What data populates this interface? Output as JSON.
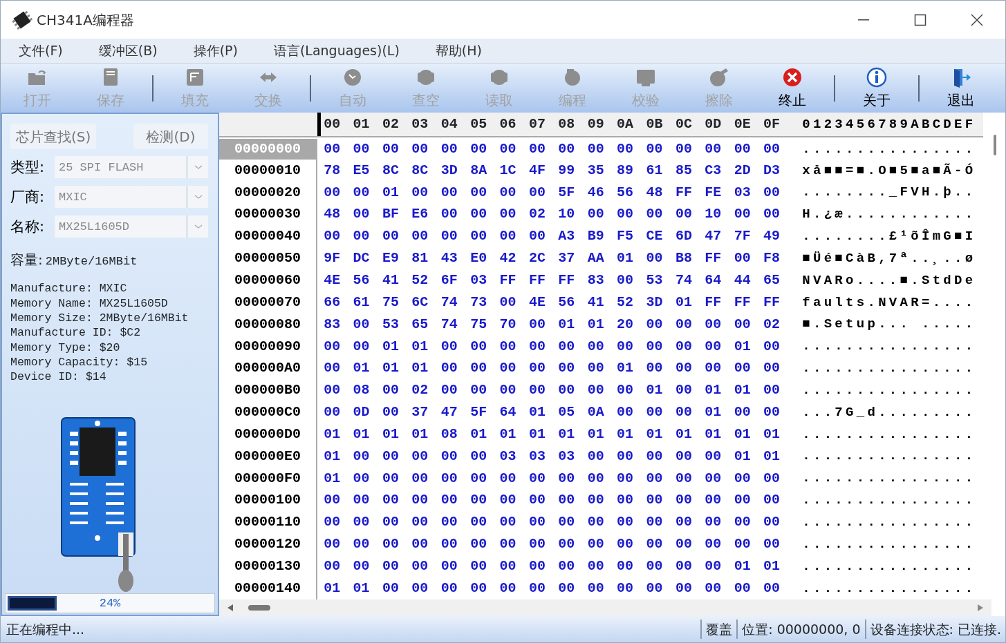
{
  "window": {
    "title": "CH341A编程器"
  },
  "menu": [
    {
      "label": "文件(F)"
    },
    {
      "label": "缓冲区(B)"
    },
    {
      "label": "操作(P)"
    },
    {
      "label": "语言(Languages)(L)"
    },
    {
      "label": "帮助(H)"
    }
  ],
  "toolbar": [
    {
      "kind": "open",
      "label": "打开",
      "disabled": true
    },
    {
      "kind": "save",
      "label": "保存",
      "disabled": true
    },
    {
      "kind": "separator"
    },
    {
      "kind": "fill",
      "label": "填充",
      "disabled": true
    },
    {
      "kind": "swap",
      "label": "交换",
      "disabled": true
    },
    {
      "kind": "separator"
    },
    {
      "kind": "auto",
      "label": "自动",
      "disabled": true
    },
    {
      "kind": "blank",
      "label": "查空",
      "disabled": true
    },
    {
      "kind": "read",
      "label": "读取",
      "disabled": true
    },
    {
      "kind": "program",
      "label": "编程",
      "disabled": true
    },
    {
      "kind": "verify",
      "label": "校验",
      "disabled": true
    },
    {
      "kind": "erase",
      "label": "擦除",
      "disabled": true
    },
    {
      "kind": "stop",
      "label": "终止",
      "disabled": false
    },
    {
      "kind": "separator"
    },
    {
      "kind": "about",
      "label": "关于",
      "disabled": false
    },
    {
      "kind": "separator"
    },
    {
      "kind": "exit",
      "label": "退出",
      "disabled": false
    }
  ],
  "chip_panel": {
    "buttons": [
      {
        "label": "芯片查找(S)",
        "disabled": true
      },
      {
        "label": "检测(D)",
        "disabled": true
      }
    ],
    "fields": [
      {
        "label": "类型:",
        "value": "25 SPI FLASH",
        "disabled": true
      },
      {
        "label": "厂商:",
        "value": "MXIC",
        "disabled": true
      },
      {
        "label": "名称:",
        "value": "MX25L1605D",
        "disabled": true
      }
    ],
    "capacity": {
      "label": "容量:",
      "value": "2MByte/16MBit"
    },
    "info": [
      "Manufacture: MXIC",
      "Memory Name: MX25L1605D",
      "Memory Size: 2MByte/16MBit",
      "Manufacture ID: $C2",
      "Memory Type: $20",
      "Memory Capacity: $15",
      "Device ID: $14"
    ],
    "progress": {
      "level": 0.24,
      "reading": "24%"
    }
  },
  "hex": {
    "columns": [
      {
        "label": "00",
        "selected": true
      },
      {
        "label": "01",
        "selected": false
      },
      {
        "label": "02",
        "selected": false
      },
      {
        "label": "03",
        "selected": false
      },
      {
        "label": "04",
        "selected": false
      },
      {
        "label": "05",
        "selected": false
      },
      {
        "label": "06",
        "selected": false
      },
      {
        "label": "07",
        "selected": false
      },
      {
        "label": "08",
        "selected": false
      },
      {
        "label": "09",
        "selected": false
      },
      {
        "label": "0A",
        "selected": false
      },
      {
        "label": "0B",
        "selected": false
      },
      {
        "label": "0C",
        "selected": false
      },
      {
        "label": "0D",
        "selected": false
      },
      {
        "label": "0E",
        "selected": false
      },
      {
        "label": "0F",
        "selected": false
      }
    ],
    "ascii_header": "0123456789ABCDEF",
    "rows": [
      {
        "address": "00000000",
        "selected": true,
        "bytes": [
          "00",
          "00",
          "00",
          "00",
          "00",
          "00",
          "00",
          "00",
          "00",
          "00",
          "00",
          "00",
          "00",
          "00",
          "00",
          "00"
        ],
        "ascii": "................"
      },
      {
        "address": "00000010",
        "selected": false,
        "bytes": [
          "78",
          "E5",
          "8C",
          "8C",
          "3D",
          "8A",
          "1C",
          "4F",
          "99",
          "35",
          "89",
          "61",
          "85",
          "C3",
          "2D",
          "D3"
        ],
        "ascii": "xå■■=■.O■5■a■Ã-Ó"
      },
      {
        "address": "00000020",
        "selected": false,
        "bytes": [
          "00",
          "00",
          "01",
          "00",
          "00",
          "00",
          "00",
          "00",
          "5F",
          "46",
          "56",
          "48",
          "FF",
          "FE",
          "03",
          "00"
        ],
        "ascii": "........_FVH.þ.."
      },
      {
        "address": "00000030",
        "selected": false,
        "bytes": [
          "48",
          "00",
          "BF",
          "E6",
          "00",
          "00",
          "00",
          "02",
          "10",
          "00",
          "00",
          "00",
          "00",
          "10",
          "00",
          "00"
        ],
        "ascii": "H.¿æ............"
      },
      {
        "address": "00000040",
        "selected": false,
        "bytes": [
          "00",
          "00",
          "00",
          "00",
          "00",
          "00",
          "00",
          "00",
          "A3",
          "B9",
          "F5",
          "CE",
          "6D",
          "47",
          "7F",
          "49"
        ],
        "ascii": "........£¹õÎmG■I"
      },
      {
        "address": "00000050",
        "selected": false,
        "bytes": [
          "9F",
          "DC",
          "E9",
          "81",
          "43",
          "E0",
          "42",
          "2C",
          "37",
          "AA",
          "01",
          "00",
          "B8",
          "FF",
          "00",
          "F8"
        ],
        "ascii": "■Üé■CàB,7ª..¸..ø"
      },
      {
        "address": "00000060",
        "selected": false,
        "bytes": [
          "4E",
          "56",
          "41",
          "52",
          "6F",
          "03",
          "FF",
          "FF",
          "FF",
          "83",
          "00",
          "53",
          "74",
          "64",
          "44",
          "65"
        ],
        "ascii": "NVARo....■.StdDe"
      },
      {
        "address": "00000070",
        "selected": false,
        "bytes": [
          "66",
          "61",
          "75",
          "6C",
          "74",
          "73",
          "00",
          "4E",
          "56",
          "41",
          "52",
          "3D",
          "01",
          "FF",
          "FF",
          "FF"
        ],
        "ascii": "faults.NVAR=...."
      },
      {
        "address": "00000080",
        "selected": false,
        "bytes": [
          "83",
          "00",
          "53",
          "65",
          "74",
          "75",
          "70",
          "00",
          "01",
          "01",
          "20",
          "00",
          "00",
          "00",
          "00",
          "02"
        ],
        "ascii": "■.Setup... ....."
      },
      {
        "address": "00000090",
        "selected": false,
        "bytes": [
          "00",
          "00",
          "01",
          "01",
          "00",
          "00",
          "00",
          "00",
          "00",
          "00",
          "00",
          "00",
          "00",
          "00",
          "01",
          "00"
        ],
        "ascii": "................"
      },
      {
        "address": "000000A0",
        "selected": false,
        "bytes": [
          "00",
          "01",
          "01",
          "01",
          "00",
          "00",
          "00",
          "00",
          "00",
          "00",
          "01",
          "00",
          "00",
          "00",
          "00",
          "00"
        ],
        "ascii": "................"
      },
      {
        "address": "000000B0",
        "selected": false,
        "bytes": [
          "00",
          "08",
          "00",
          "02",
          "00",
          "00",
          "00",
          "00",
          "00",
          "00",
          "00",
          "01",
          "00",
          "01",
          "01",
          "00"
        ],
        "ascii": "................"
      },
      {
        "address": "000000C0",
        "selected": false,
        "bytes": [
          "00",
          "0D",
          "00",
          "37",
          "47",
          "5F",
          "64",
          "01",
          "05",
          "0A",
          "00",
          "00",
          "00",
          "01",
          "00",
          "00"
        ],
        "ascii": "...7G_d........."
      },
      {
        "address": "000000D0",
        "selected": false,
        "bytes": [
          "01",
          "01",
          "01",
          "01",
          "08",
          "01",
          "01",
          "01",
          "01",
          "01",
          "01",
          "01",
          "01",
          "01",
          "01",
          "01"
        ],
        "ascii": "................"
      },
      {
        "address": "000000E0",
        "selected": false,
        "bytes": [
          "01",
          "00",
          "00",
          "00",
          "00",
          "00",
          "03",
          "03",
          "03",
          "00",
          "00",
          "00",
          "00",
          "00",
          "01",
          "01"
        ],
        "ascii": "................"
      },
      {
        "address": "000000F0",
        "selected": false,
        "bytes": [
          "01",
          "00",
          "00",
          "00",
          "00",
          "00",
          "00",
          "00",
          "00",
          "00",
          "00",
          "00",
          "00",
          "00",
          "00",
          "00"
        ],
        "ascii": "................"
      },
      {
        "address": "00000100",
        "selected": false,
        "bytes": [
          "00",
          "00",
          "00",
          "00",
          "00",
          "00",
          "00",
          "00",
          "00",
          "00",
          "00",
          "00",
          "00",
          "00",
          "00",
          "00"
        ],
        "ascii": "................"
      },
      {
        "address": "00000110",
        "selected": false,
        "bytes": [
          "00",
          "00",
          "00",
          "00",
          "00",
          "00",
          "00",
          "00",
          "00",
          "00",
          "00",
          "00",
          "00",
          "00",
          "00",
          "00"
        ],
        "ascii": "................"
      },
      {
        "address": "00000120",
        "selected": false,
        "bytes": [
          "00",
          "00",
          "00",
          "00",
          "00",
          "00",
          "00",
          "00",
          "00",
          "00",
          "00",
          "00",
          "00",
          "00",
          "00",
          "00"
        ],
        "ascii": "................"
      },
      {
        "address": "00000130",
        "selected": false,
        "bytes": [
          "00",
          "00",
          "00",
          "00",
          "00",
          "00",
          "00",
          "00",
          "00",
          "00",
          "00",
          "00",
          "00",
          "00",
          "01",
          "01"
        ],
        "ascii": "................"
      },
      {
        "address": "00000140",
        "selected": false,
        "bytes": [
          "01",
          "01",
          "00",
          "00",
          "00",
          "00",
          "00",
          "00",
          "00",
          "00",
          "00",
          "00",
          "00",
          "00",
          "00",
          "00"
        ],
        "ascii": "................"
      }
    ]
  },
  "status_bar": {
    "message": "正在编程中...",
    "mode": "覆盖",
    "position": "位置: 00000000, 0",
    "connection": "设备连接状态: 已连接."
  }
}
